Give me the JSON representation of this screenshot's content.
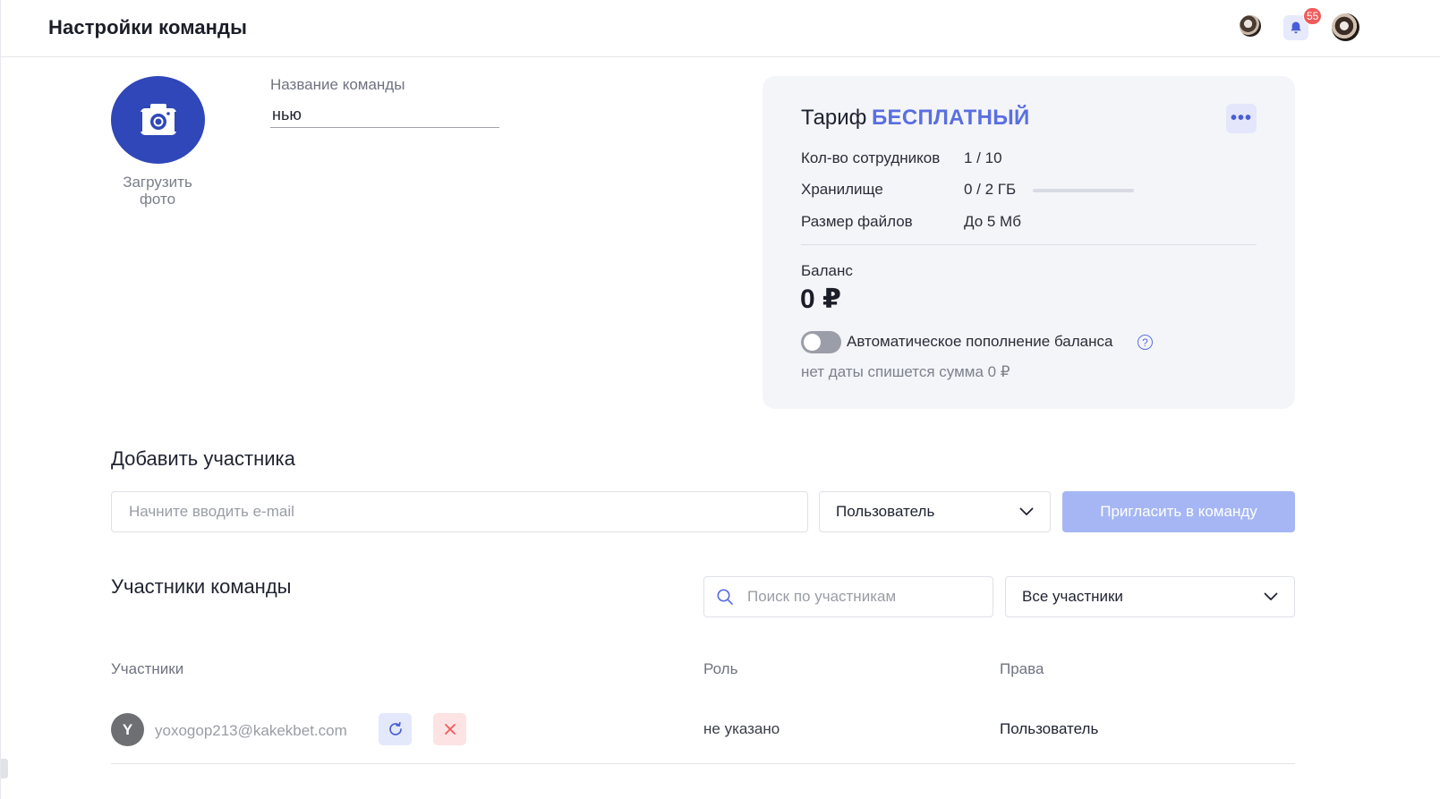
{
  "header": {
    "title": "Настройки команды",
    "notifications_count": "55"
  },
  "photo": {
    "upload_label": "Загрузить фото"
  },
  "team": {
    "name_label": "Название команды",
    "name_value": "нью"
  },
  "tariff": {
    "title": "Тариф",
    "plan": "БЕСПЛАТНЫЙ",
    "more_label": "•••",
    "employees_label": "Кол-во сотрудников",
    "employees_value": "1 / 10",
    "storage_label": "Хранилище",
    "storage_value": "0 / 2 ГБ",
    "storage_fraction": 0,
    "file_size_label": "Размер файлов",
    "file_size_value": "До 5 Мб",
    "balance_label": "Баланс",
    "balance_value": "0 ₽",
    "auto_topup_label": "Автоматическое пополнение баланса",
    "auto_topup_enabled": false,
    "help_glyph": "?",
    "auto_topup_note": "нет даты спишется сумма 0 ₽"
  },
  "add_member": {
    "title": "Добавить участника",
    "email_placeholder": "Начните вводить e-mail",
    "role_selected": "Пользователь",
    "invite_label": "Пригласить в команду"
  },
  "members": {
    "title": "Участники команды",
    "search_placeholder": "Поиск по участникам",
    "filter_selected": "Все участники",
    "columns": [
      "Участники",
      "Роль",
      "Права"
    ],
    "rows": [
      {
        "initial": "Y",
        "email": "yoxogop213@kakekbet.com",
        "role": "не указано",
        "rights": "Пользователь"
      }
    ]
  },
  "colors": {
    "accent": "#5a6fe0",
    "avatar_bg": "#2f47b8",
    "invite_disabled": "#a6b6f4",
    "badge": "#ef5b5b",
    "danger_bg": "#fde3e3"
  },
  "icons": [
    "bell-icon",
    "camera-icon",
    "more-icon",
    "help-icon",
    "chevron-down-icon",
    "search-icon",
    "refresh-icon",
    "close-icon"
  ]
}
